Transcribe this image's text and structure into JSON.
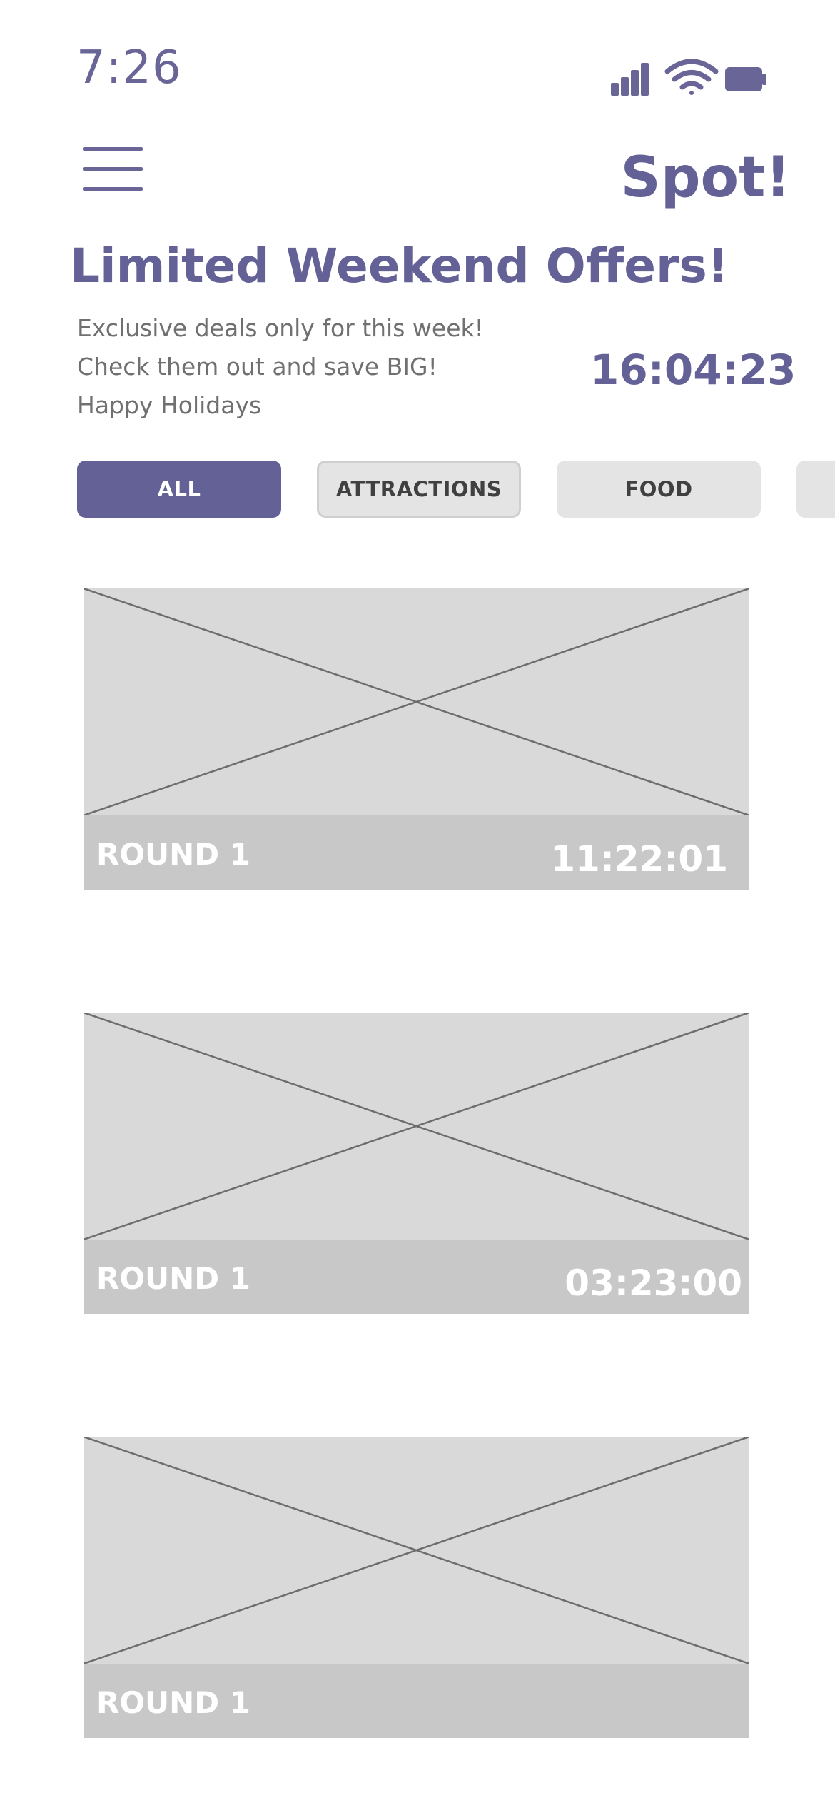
{
  "status_bar": {
    "time": "7:26",
    "icons": [
      "signal-icon",
      "wifi-icon",
      "battery-icon"
    ]
  },
  "header": {
    "menu_icon": "hamburger-menu-icon",
    "brand": "Spot!"
  },
  "promo": {
    "title": "Limited Weekend Offers!",
    "lines": [
      "Exclusive deals only for this week!",
      "Check them out and save BIG!",
      "Happy Holidays"
    ],
    "countdown": "16:04:23"
  },
  "filters": [
    {
      "label": "ALL",
      "selected": true
    },
    {
      "label": "ATTRACTIONS",
      "selected": false
    },
    {
      "label": "FOOD",
      "selected": false
    },
    {
      "label": "",
      "selected": false
    }
  ],
  "cards": [
    {
      "label": "ROUND 1",
      "timer": "11:22:01"
    },
    {
      "label": "ROUND 1",
      "timer": "03:23:00"
    },
    {
      "label": "ROUND 1",
      "timer": ""
    }
  ],
  "colors": {
    "accent": "#646196",
    "placeholder": "#d9d9d9",
    "card_footer": "#c8c8c8",
    "chip_inactive": "#e4e4e4",
    "body_text": "#707070"
  }
}
